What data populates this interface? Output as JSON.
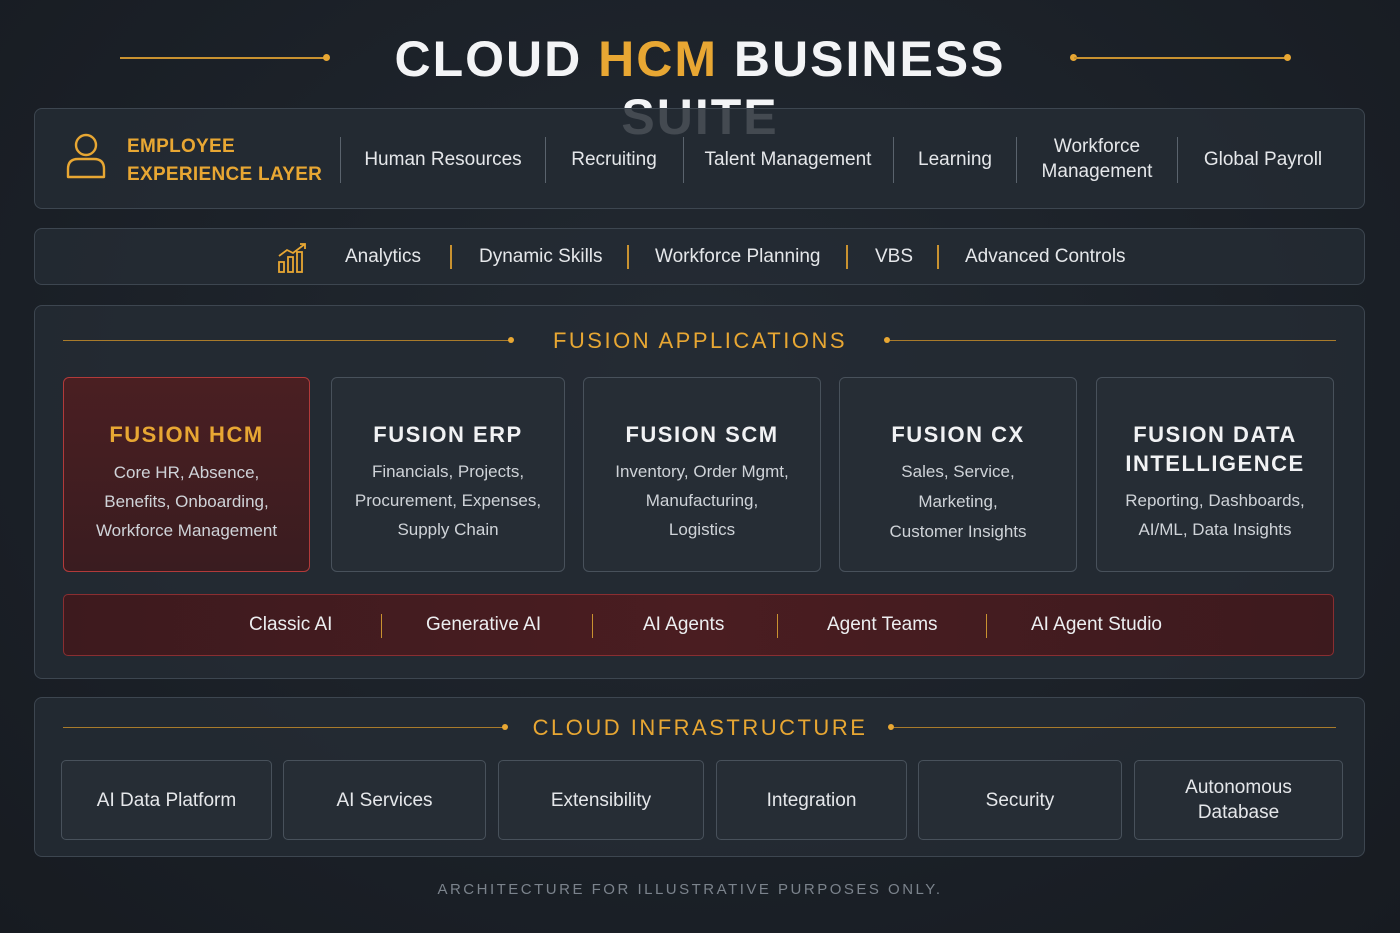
{
  "title": {
    "part1": "CLOUD ",
    "highlight": "HCM",
    "part2": " BUSINESS SUITE"
  },
  "employee_layer": {
    "icon": "person-icon",
    "label_line1": "EMPLOYEE",
    "label_line2": "EXPERIENCE LAYER",
    "items": [
      {
        "label": "Human Resources"
      },
      {
        "label": "Recruiting"
      },
      {
        "label": "Talent Management"
      },
      {
        "label": "Learning"
      },
      {
        "label_line1": "Workforce",
        "label_line2": "Management"
      },
      {
        "label": "Global Payroll"
      }
    ]
  },
  "analytics_bar": {
    "icon": "bar-chart-trend-icon",
    "items": [
      "Analytics",
      "Dynamic Skills",
      "Workforce Planning",
      "VBS",
      "Advanced Controls"
    ]
  },
  "fusion_applications": {
    "heading": "FUSION APPLICATIONS",
    "cards": [
      {
        "title": "FUSION HCM",
        "desc": [
          "Core HR, Absence,",
          "Benefits, Onboarding,",
          "Workforce Management"
        ],
        "highlighted": true
      },
      {
        "title": "FUSION ERP",
        "desc": [
          "Financials, Projects,",
          "Procurement, Expenses,",
          "Supply Chain"
        ]
      },
      {
        "title": "FUSION SCM",
        "desc": [
          "Inventory, Order Mgmt,",
          "Manufacturing,",
          "Logistics"
        ]
      },
      {
        "title": "FUSION CX",
        "desc": [
          "Sales, Service,",
          "Marketing,",
          "Customer Insights"
        ]
      },
      {
        "title_line1": "FUSION DATA",
        "title_line2": "INTELLIGENCE",
        "desc": [
          "Reporting, Dashboards,",
          "AI/ML, Data Insights"
        ]
      }
    ],
    "ai_bar": [
      "Classic AI",
      "Generative AI",
      "AI Agents",
      "Agent Teams",
      "AI Agent Studio"
    ]
  },
  "cloud_infrastructure": {
    "heading": "CLOUD INFRASTRUCTURE",
    "items": [
      {
        "label": "AI Data Platform"
      },
      {
        "label": "AI Services"
      },
      {
        "label": "Extensibility"
      },
      {
        "label": "Integration"
      },
      {
        "label": "Security"
      },
      {
        "label_line1": "Autonomous",
        "label_line2": "Database"
      }
    ]
  },
  "footnote": "ARCHITECTURE FOR ILLUSTRATIVE PURPOSES ONLY.",
  "colors": {
    "accent": "#e8a733",
    "background": "#1c222a",
    "highlight_red": "#b23a3a"
  }
}
